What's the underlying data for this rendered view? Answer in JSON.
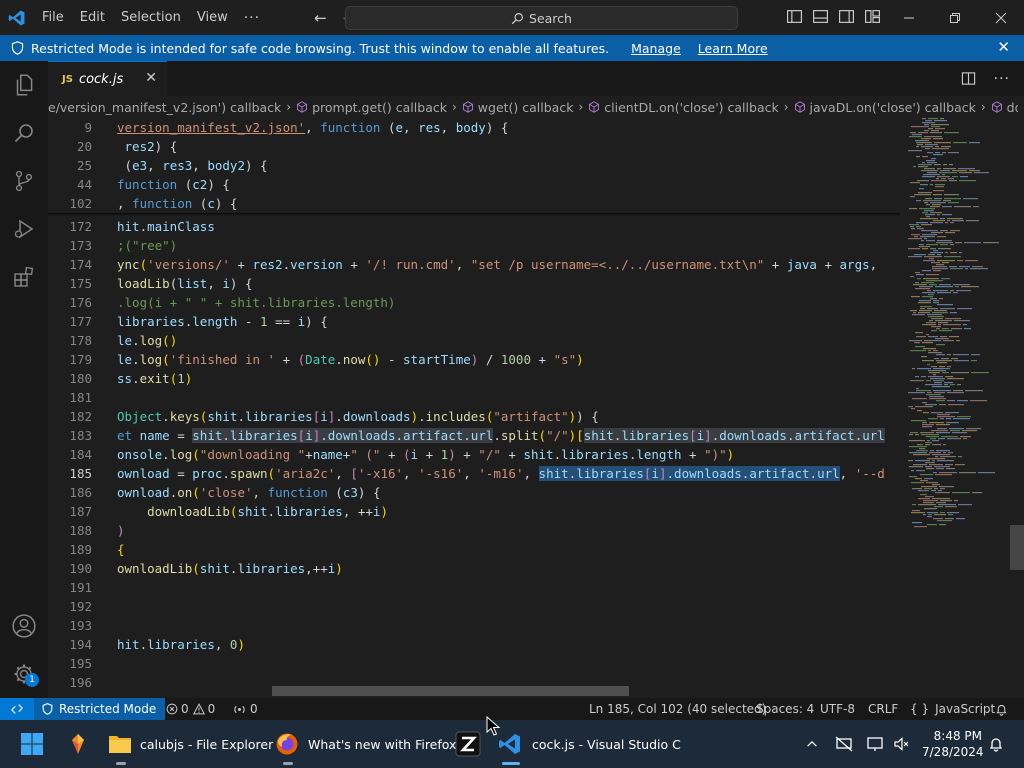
{
  "titlebar": {
    "menu": [
      "File",
      "Edit",
      "Selection",
      "View"
    ],
    "more": "···",
    "search_placeholder": "Search"
  },
  "banner": {
    "message": "Restricted Mode is intended for safe code browsing. Trust this window to enable all features.",
    "manage": "Manage",
    "learn_more": "Learn More"
  },
  "activitybar": {
    "badge_count": "1"
  },
  "tab": {
    "icon_text": "JS",
    "filename": "cock.js"
  },
  "breadcrumb": {
    "items": [
      "e/version_manifest_v2.json') callback",
      "prompt.get() callback",
      "wget() callback",
      "clientDL.on('close') callback",
      "javaDL.on('close') callback",
      "downloadLib"
    ]
  },
  "code": {
    "sticky_lines": [
      {
        "num": "9"
      },
      {
        "num": "20"
      },
      {
        "num": "25"
      },
      {
        "num": "44"
      },
      {
        "num": "102"
      }
    ],
    "lines": [
      {
        "num": "172"
      },
      {
        "num": "173"
      },
      {
        "num": "174"
      },
      {
        "num": "175"
      },
      {
        "num": "176"
      },
      {
        "num": "177"
      },
      {
        "num": "178"
      },
      {
        "num": "179"
      },
      {
        "num": "180"
      },
      {
        "num": "181"
      },
      {
        "num": "182"
      },
      {
        "num": "183"
      },
      {
        "num": "184"
      },
      {
        "num": "185"
      },
      {
        "num": "186"
      },
      {
        "num": "187"
      },
      {
        "num": "188"
      },
      {
        "num": "189"
      },
      {
        "num": "190"
      },
      {
        "num": "191"
      },
      {
        "num": "192"
      },
      {
        "num": "193"
      },
      {
        "num": "194"
      },
      {
        "num": "195"
      },
      {
        "num": "196"
      }
    ]
  },
  "statusbar": {
    "restricted_mode": "Restricted Mode",
    "errors": "0",
    "warnings": "0",
    "ports": "0",
    "cursor_position": "Ln 185, Col 102 (40 selected)",
    "indentation": "Spaces: 4",
    "encoding": "UTF-8",
    "eol": "CRLF",
    "language_braces": "{ }",
    "language": "JavaScript"
  },
  "taskbar": {
    "explorer_label": "calubjs - File Explorer",
    "firefox_label": "What's new with Firefox",
    "vscode_label": "cock.js - Visual Studio C",
    "time": "8:48 PM",
    "date": "7/28/2024"
  },
  "colors": {
    "accent": "#0078d4",
    "banner": "#0a5fa6",
    "selection": "#264f78",
    "taskbar": "#1c2a3a"
  }
}
